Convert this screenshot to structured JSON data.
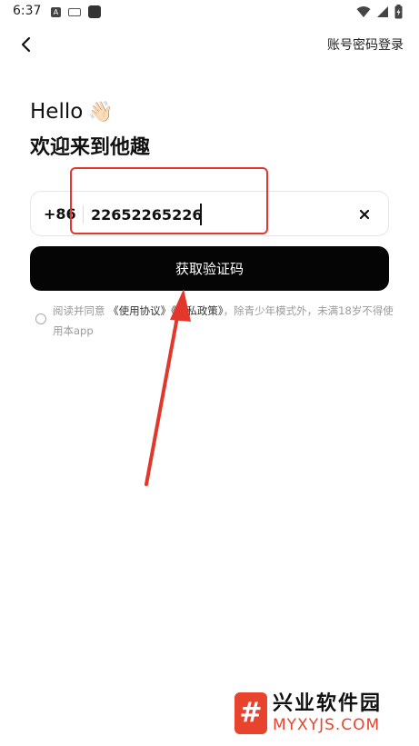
{
  "status_bar": {
    "time": "6:37",
    "notif_letter": "A"
  },
  "header": {
    "pwd_login_label": "账号密码登录"
  },
  "greeting": {
    "hello": "Hello",
    "wave_emoji": "👋🏻",
    "welcome": "欢迎来到他趣"
  },
  "phone": {
    "country_code": "+86",
    "value": "22652265226"
  },
  "actions": {
    "get_code_label": "获取验证码"
  },
  "agreement": {
    "prefix": "阅读并同意 ",
    "terms_link": "《使用协议》",
    "privacy_link": "《隐私政策》",
    "suffix": "，除青少年模式外，未满18岁不得使用本app"
  },
  "watermark": {
    "name_cn": "兴业软件园",
    "name_en": "MYXYJS.COM",
    "logo_char": "#"
  },
  "colors": {
    "accent_red": "#e2382b",
    "button_bg": "#050505"
  }
}
